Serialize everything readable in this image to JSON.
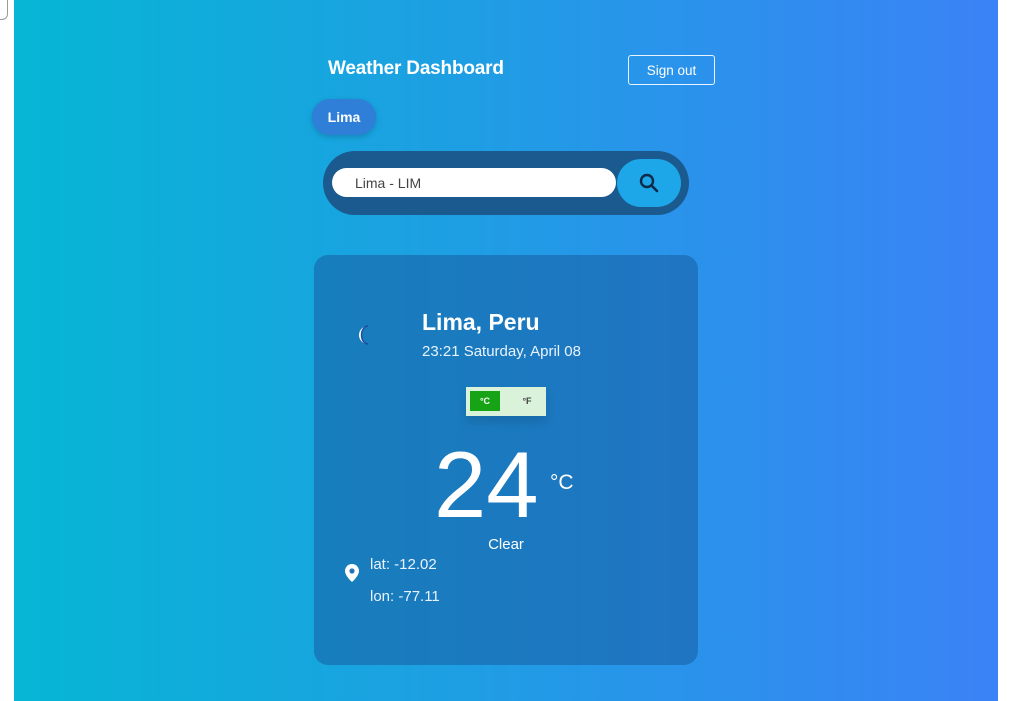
{
  "header": {
    "title": "Weather Dashboard",
    "signout_label": "Sign out"
  },
  "saved_cities": [
    {
      "label": "Lima"
    }
  ],
  "search": {
    "value": "Lima - LIM",
    "icon": "search-icon"
  },
  "weather": {
    "location": "Lima, Peru",
    "datetime": "23:21 Saturday, April 08",
    "icon": "moon-icon",
    "temperature": "24",
    "unit": "°C",
    "condition": "Clear",
    "units": {
      "celsius": "°C",
      "fahrenheit": "°F",
      "selected": "celsius"
    },
    "coordinates": {
      "lat": "lat: -12.02",
      "lon": "lon: -77.11",
      "icon": "map-pin-icon"
    }
  },
  "colors": {
    "gradient_start": "#06b6d4",
    "gradient_end": "#3b82f6",
    "active_unit": "#16a316",
    "search_button": "#1da7e8"
  }
}
